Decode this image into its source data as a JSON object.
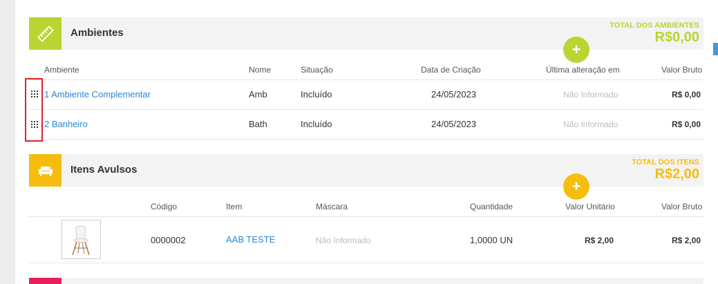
{
  "colors": {
    "lime": "#b9d531",
    "amber": "#f6bd0e",
    "link": "#2a86d6",
    "red_highlight": "#e0202c",
    "pink": "#e8205a",
    "blue_accent": "#3d9ae0"
  },
  "ambientes": {
    "title": "Ambientes",
    "icon": "ruler-icon",
    "total_label": "TOTAL DOS AMBIENTES",
    "total_value": "R$0,00",
    "add_label": "+",
    "columns": [
      "Ambiente",
      "Nome",
      "Situação",
      "Data de Criação",
      "Última alteração em",
      "Valor Bruto"
    ],
    "rows": [
      {
        "ambiente": "1 Ambiente Complementar",
        "nome": "Amb",
        "situacao": "Incluído",
        "data": "24/05/2023",
        "ultima": "Não Informado",
        "valor": "R$ 0,00"
      },
      {
        "ambiente": "2 Banheiro",
        "nome": "Bath",
        "situacao": "Incluído",
        "data": "24/05/2023",
        "ultima": "Não Informado",
        "valor": "R$ 0,00"
      }
    ]
  },
  "itens": {
    "title": "Itens Avulsos",
    "icon": "sofa-icon",
    "total_label": "TOTAL DOS ITENS",
    "total_value": "R$2,00",
    "add_label": "+",
    "columns": [
      "Código",
      "Item",
      "Máscara",
      "Quantidade",
      "Valor Unitário",
      "Valor Bruto"
    ],
    "rows": [
      {
        "codigo": "0000002",
        "item": "AAB TESTE",
        "mascara": "Não Informado",
        "quantidade": "1,0000 UN",
        "unitario": "R$ 2,00",
        "bruto": "R$ 2,00",
        "thumb_icon": "chair-icon"
      }
    ]
  }
}
